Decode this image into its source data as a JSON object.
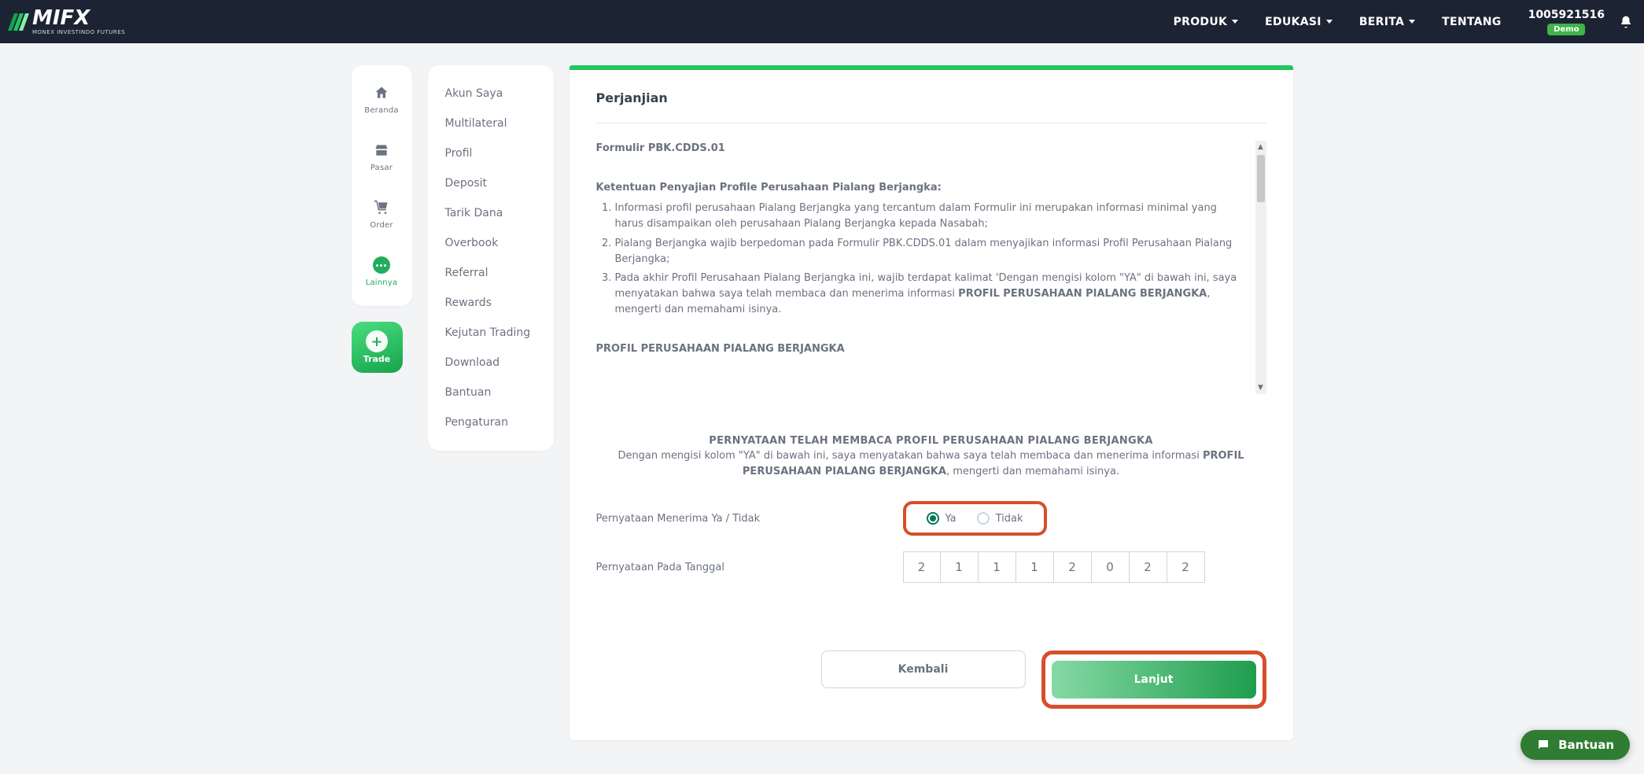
{
  "brand": {
    "name": "MIFX",
    "tagline": "MONEX INVESTINDO FUTURES"
  },
  "topnav": {
    "items": [
      {
        "label": "PRODUK",
        "has_caret": true
      },
      {
        "label": "EDUKASI",
        "has_caret": true
      },
      {
        "label": "BERITA",
        "has_caret": true
      },
      {
        "label": "TENTANG",
        "has_caret": false
      }
    ],
    "account_id": "1005921516",
    "badge": "Demo"
  },
  "rail": {
    "items": [
      {
        "key": "beranda",
        "label": "Beranda"
      },
      {
        "key": "pasar",
        "label": "Pasar"
      },
      {
        "key": "order",
        "label": "Order"
      },
      {
        "key": "lainnya",
        "label": "Lainnya"
      }
    ],
    "trade_label": "Trade"
  },
  "submenu": {
    "items": [
      "Akun Saya",
      "Multilateral",
      "Profil",
      "Deposit",
      "Tarik Dana",
      "Overbook",
      "Referral",
      "Rewards",
      "Kejutan Trading",
      "Download",
      "Bantuan",
      "Pengaturan"
    ]
  },
  "card": {
    "title": "Perjanjian",
    "doc": {
      "form_code": "Formulir PBK.CDDS.01",
      "subheading": "Ketentuan Penyajian Profile Perusahaan Pialang Berjangka:",
      "bullets": [
        "Informasi profil perusahaan Pialang Berjangka yang tercantum dalam Formulir ini merupakan informasi minimal yang harus disampaikan oleh perusahaan Pialang Berjangka kepada Nasabah;",
        "Pialang Berjangka wajib berpedoman pada Formulir PBK.CDDS.01 dalam menyajikan informasi Profil Perusahaan Pialang Berjangka;",
        "__HTML__:Pada akhir Profil Perusahaan Pialang Berjangka ini, wajib terdapat kalimat 'Dengan mengisi kolom \"YA\" di bawah ini, saya menyatakan bahwa saya telah membaca dan menerima informasi <b>PROFIL PERUSAHAAN PIALANG BERJANGKA</b>, mengerti dan memahami isinya."
      ],
      "section_title": "PROFIL PERUSAHAAN PIALANG BERJANGKA"
    },
    "statement": {
      "title": "PERNYATAAN TELAH MEMBACA PROFIL PERUSAHAAN PIALANG BERJANGKA",
      "text_html": "Dengan mengisi kolom \"YA\" di bawah ini, saya menyatakan bahwa saya telah membaca dan menerima informasi <b>PROFIL PERUSAHAAN PIALANG BERJANGKA</b>, mengerti dan memahami isinya."
    },
    "form": {
      "accept_label": "Pernyataan Menerima Ya / Tidak",
      "accept_options": {
        "yes": "Ya",
        "no": "Tidak"
      },
      "accept_selected": "yes",
      "date_label": "Pernyataan Pada Tanggal",
      "date_digits": [
        "2",
        "1",
        "1",
        "1",
        "2",
        "0",
        "2",
        "2"
      ]
    },
    "buttons": {
      "back": "Kembali",
      "next": "Lanjut"
    }
  },
  "help_bubble": "Bantuan"
}
